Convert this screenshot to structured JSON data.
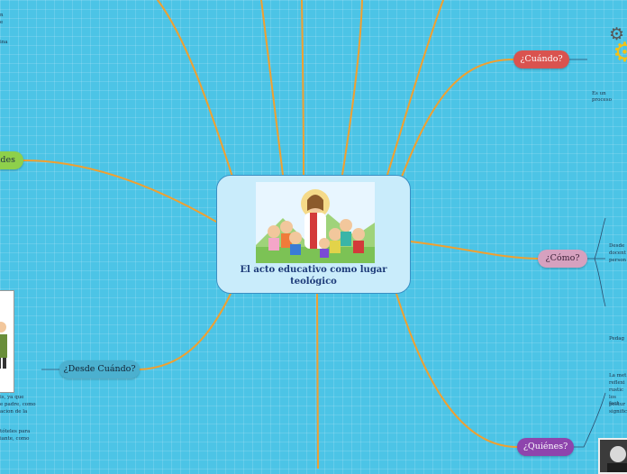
{
  "central": {
    "title": "El acto educativo como lugar teológico",
    "image": "jesus-with-children-illustration"
  },
  "nodes": {
    "cuando": "¿Cuándo?",
    "como": "¿Cómo?",
    "quienes": "¿Quiénes?",
    "desde_cuando": "¿Desde Cuándo?",
    "left_partial": "ides"
  },
  "snippets": {
    "cuando_text": "Es un proceso",
    "como_text_1": "Desde",
    "como_text_2": "docent",
    "como_text_3": "person",
    "pedag": "Pedag",
    "quienes_1": "La met",
    "quienes_2": "reflexi",
    "quienes_3": "rustic",
    "quienes_4": "los fact",
    "quienes_5": "postur",
    "quienes_6": "signific",
    "left_1": "is, ya que",
    "left_2": "e padre, como",
    "left_3": "acion de la",
    "left_4": "tóteles para",
    "left_5": "iante, como",
    "top_left_1": "n",
    "top_left_2": "e",
    "top_left_3": "ina"
  },
  "colors": {
    "background": "#4cc4e6",
    "connector": "#f0a030",
    "cuando": "#d9534f",
    "como": "#d6a1bf",
    "quienes": "#8e44ad",
    "desde_cuando": "#4bb0cf",
    "left_partial": "#8ed04b"
  },
  "icons": [
    "gear-icon",
    "gear-icon"
  ]
}
